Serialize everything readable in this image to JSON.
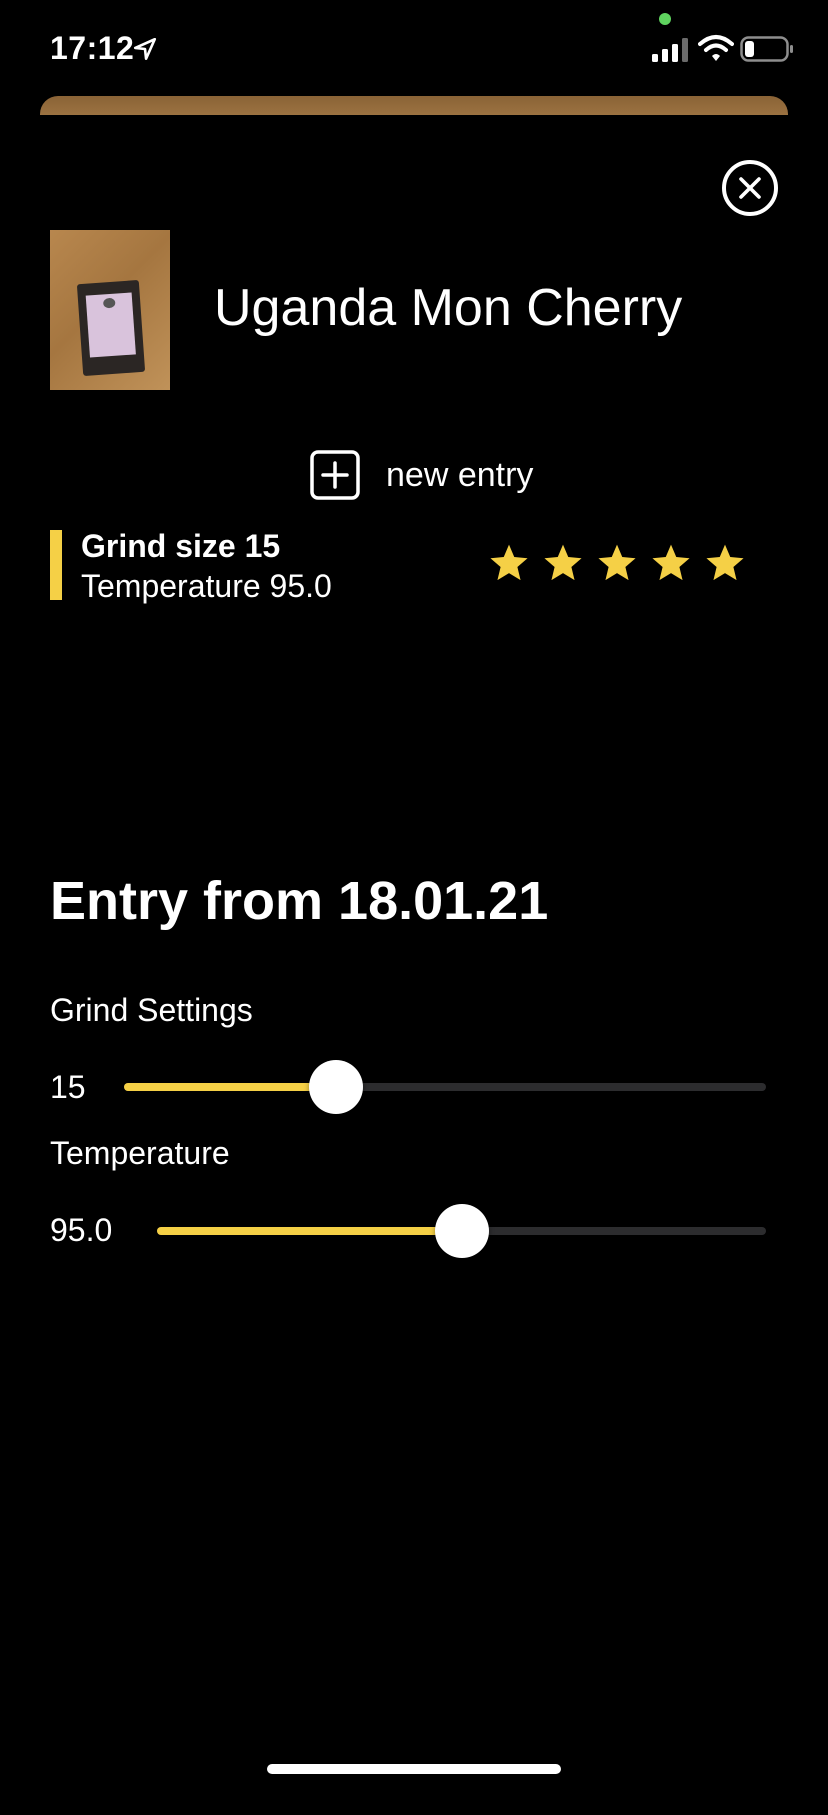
{
  "status_bar": {
    "time": "17:12"
  },
  "coffee": {
    "name": "Uganda Mon Cherry"
  },
  "actions": {
    "new_entry_label": "new entry"
  },
  "entries": [
    {
      "line1": "Grind size 15",
      "line2": "Temperature 95.0",
      "rating": 5,
      "rating_max": 5
    }
  ],
  "detail": {
    "title": "Entry from 18.01.21",
    "grind": {
      "label": "Grind Settings",
      "value_text": "15",
      "fraction": 0.33
    },
    "temperature": {
      "label": "Temperature",
      "value_text": "95.0",
      "fraction": 0.5
    }
  },
  "colors": {
    "accent": "#f5d046",
    "background": "#000000",
    "track": "#2c2c2e"
  },
  "icons": {
    "close": "close-icon",
    "new_entry": "plus-square-icon",
    "star": "star-icon",
    "location": "location-arrow-icon"
  }
}
